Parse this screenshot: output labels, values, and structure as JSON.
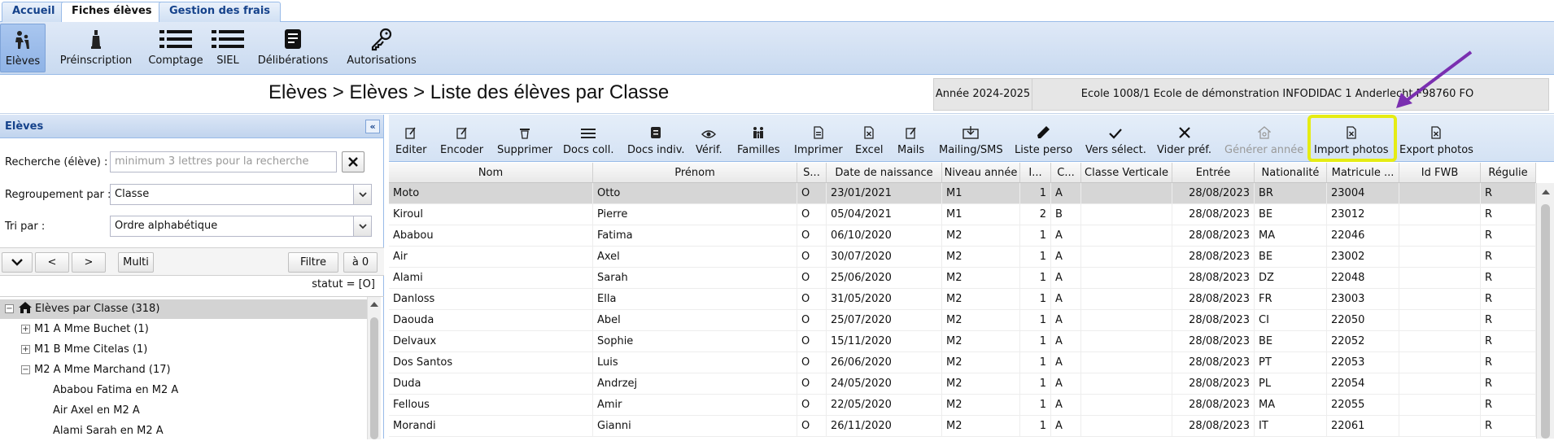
{
  "tabs": [
    {
      "label": "Accueil"
    },
    {
      "label": "Fiches élèves"
    },
    {
      "label": "Gestion des frais"
    }
  ],
  "ribbon": [
    {
      "label": "Elèves",
      "icon": "students-icon"
    },
    {
      "label": "Préinscription",
      "icon": "preregistration-icon"
    },
    {
      "label": "Comptage",
      "icon": "list-icon"
    },
    {
      "label": "SIEL",
      "icon": "list-icon"
    },
    {
      "label": "Délibérations",
      "icon": "document-icon"
    },
    {
      "label": "Autorisations",
      "icon": "key-icon"
    }
  ],
  "header": {
    "title": "Elèves > Elèves > Liste des élèves par Classe",
    "year": "Année 2024-2025",
    "school": "Ecole 1008/1 Ecole de démonstration INFODIDAC 1 Anderlecht F98760 FO"
  },
  "left_panel": {
    "title": "Elèves",
    "search_label": "Recherche (élève) :",
    "search_placeholder": "minimum 3 lettres pour la recherche",
    "group_label": "Regroupement par :",
    "group_value": "Classe",
    "sort_label": "Tri par :",
    "sort_value": "Ordre alphabétique",
    "nav": {
      "prev": "<",
      "next": ">",
      "multi": "Multi",
      "filter": "Filtre",
      "reset": "à 0"
    },
    "statut": "statut = [O]",
    "tree": [
      {
        "label": "Elèves par Classe (318)"
      },
      {
        "label": "M1 A Mme Buchet (1)"
      },
      {
        "label": "M1 B Mme Citelas (1)"
      },
      {
        "label": "M2 A Mme Marchand (17)"
      },
      {
        "label": "Ababou Fatima en M2 A"
      },
      {
        "label": "Air Axel en M2 A"
      },
      {
        "label": "Alami Sarah en M2 A"
      }
    ]
  },
  "toolbar": [
    {
      "label": "Editer",
      "icon": "edit-icon"
    },
    {
      "label": "Encoder",
      "icon": "encode-icon"
    },
    {
      "label": "Supprimer",
      "icon": "trash-icon"
    },
    {
      "label": "Docs coll.",
      "icon": "list-icon"
    },
    {
      "label": "Docs indiv.",
      "icon": "document-icon"
    },
    {
      "label": "Vérif.",
      "icon": "eye-icon"
    },
    {
      "label": "Familles",
      "icon": "family-icon"
    },
    {
      "label": "Imprimer",
      "icon": "print-icon"
    },
    {
      "label": "Excel",
      "icon": "excel-icon"
    },
    {
      "label": "Mails",
      "icon": "mail-edit-icon"
    },
    {
      "label": "Mailing/SMS",
      "icon": "mailing-icon"
    },
    {
      "label": "Liste perso",
      "icon": "pencil-icon"
    },
    {
      "label": "Vers sélect.",
      "icon": "check-icon"
    },
    {
      "label": "Vider préf.",
      "icon": "x-icon"
    },
    {
      "label": "Générer année",
      "icon": "generate-icon"
    },
    {
      "label": "Import photos",
      "icon": "photo-file-icon"
    },
    {
      "label": "Export photos",
      "icon": "photo-file-icon"
    }
  ],
  "grid": {
    "columns": [
      "Nom",
      "Prénom",
      "S...",
      "Date de naissance",
      "Niveau année",
      "I...",
      "C...",
      "Classe Verticale",
      "Entrée",
      "Nationalité",
      "Matricule ...",
      "Id FWB",
      "Régulie"
    ],
    "rows": [
      [
        "Moto",
        "Otto",
        "O",
        "23/01/2021",
        "M1",
        "1",
        "A",
        "",
        "28/08/2023",
        "BR",
        "23004",
        "",
        "R"
      ],
      [
        "Kiroul",
        "Pierre",
        "O",
        "05/04/2021",
        "M1",
        "2",
        "B",
        "",
        "28/08/2023",
        "BE",
        "23012",
        "",
        "R"
      ],
      [
        "Ababou",
        "Fatima",
        "O",
        "06/10/2020",
        "M2",
        "1",
        "A",
        "",
        "28/08/2023",
        "MA",
        "22046",
        "",
        "R"
      ],
      [
        "Air",
        "Axel",
        "O",
        "30/07/2020",
        "M2",
        "1",
        "A",
        "",
        "28/08/2023",
        "BE",
        "23002",
        "",
        "R"
      ],
      [
        "Alami",
        "Sarah",
        "O",
        "25/06/2020",
        "M2",
        "1",
        "A",
        "",
        "28/08/2023",
        "DZ",
        "22048",
        "",
        "R"
      ],
      [
        "Danloss",
        "Ella",
        "O",
        "31/05/2020",
        "M2",
        "1",
        "A",
        "",
        "28/08/2023",
        "FR",
        "23003",
        "",
        "R"
      ],
      [
        "Daouda",
        "Abel",
        "O",
        "25/07/2020",
        "M2",
        "1",
        "A",
        "",
        "28/08/2023",
        "CI",
        "22050",
        "",
        "R"
      ],
      [
        "Delvaux",
        "Sophie",
        "O",
        "15/11/2020",
        "M2",
        "1",
        "A",
        "",
        "28/08/2023",
        "BE",
        "22052",
        "",
        "R"
      ],
      [
        "Dos Santos",
        "Luis",
        "O",
        "26/06/2020",
        "M2",
        "1",
        "A",
        "",
        "28/08/2023",
        "PT",
        "22053",
        "",
        "R"
      ],
      [
        "Duda",
        "Andrzej",
        "O",
        "24/05/2020",
        "M2",
        "1",
        "A",
        "",
        "28/08/2023",
        "PL",
        "22054",
        "",
        "R"
      ],
      [
        "Fellous",
        "Amir",
        "O",
        "22/05/2020",
        "M2",
        "1",
        "A",
        "",
        "28/08/2023",
        "MA",
        "22055",
        "",
        "R"
      ],
      [
        "Morandi",
        "Gianni",
        "O",
        "26/11/2020",
        "M2",
        "1",
        "A",
        "",
        "28/08/2023",
        "IT",
        "22061",
        "",
        "R"
      ]
    ]
  },
  "colors": {
    "highlight": "#e5ec14",
    "arrow": "#7a2fb0",
    "header_blue": "#15428b"
  }
}
